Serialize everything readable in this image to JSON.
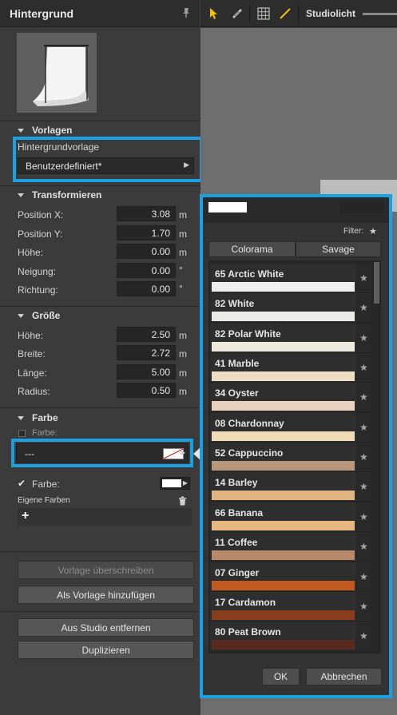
{
  "panel": {
    "title": "Hintergrund",
    "sections": {
      "vorlagen": "Vorlagen",
      "transformieren": "Transformieren",
      "groesse": "Größe",
      "farbe": "Farbe"
    },
    "vorlage": {
      "label": "Hintergrundvorlage",
      "value": "Benutzerdefiniert*"
    },
    "transform": [
      {
        "label": "Position X:",
        "value": "3.08",
        "unit": "m"
      },
      {
        "label": "Position Y:",
        "value": "1.70",
        "unit": "m"
      },
      {
        "label": "Höhe:",
        "value": "0.00",
        "unit": "m"
      },
      {
        "label": "Neigung:",
        "value": "0.00",
        "unit": "°"
      },
      {
        "label": "Richtung:",
        "value": "0.00",
        "unit": "°"
      }
    ],
    "size": [
      {
        "label": "Höhe:",
        "value": "2.50",
        "unit": "m"
      },
      {
        "label": "Breite:",
        "value": "2.72",
        "unit": "m"
      },
      {
        "label": "Länge:",
        "value": "5.00",
        "unit": "m"
      },
      {
        "label": "Radius:",
        "value": "0.50",
        "unit": "m"
      }
    ],
    "color": {
      "farbe_checkbox_label": "Farbe:",
      "dropdown_value": "---",
      "farbe2_label": "Farbe:",
      "eigene_farben": "Eigene Farben",
      "add_symbol": "+"
    },
    "buttons": {
      "overwrite": "Vorlage überschreiben",
      "add_template": "Als Vorlage hinzufügen",
      "remove": "Aus Studio entfernen",
      "duplicate": "Duplizieren"
    }
  },
  "toolbar": {
    "label": "Studiolicht"
  },
  "popup": {
    "filter_label": "Filter:",
    "tabs": [
      "Colorama",
      "Savage"
    ],
    "swatches": [
      {
        "name": "65 Arctic White",
        "color": "#efefef"
      },
      {
        "name": "82 White",
        "color": "#eaeae6"
      },
      {
        "name": "82 Polar White",
        "color": "#eee9dd"
      },
      {
        "name": "41 Marble",
        "color": "#ecdcc4"
      },
      {
        "name": "34 Oyster",
        "color": "#e6d2bf"
      },
      {
        "name": "08 Chardonnay",
        "color": "#efdcb7"
      },
      {
        "name": "52 Cappuccino",
        "color": "#b9977a"
      },
      {
        "name": "14 Barley",
        "color": "#dfb47f"
      },
      {
        "name": "66 Banana",
        "color": "#e6b77e"
      },
      {
        "name": "11 Coffee",
        "color": "#b7896a"
      },
      {
        "name": "07 Ginger",
        "color": "#c4591f"
      },
      {
        "name": "17 Cardamon",
        "color": "#8a3d1c"
      },
      {
        "name": "80 Peat Brown",
        "color": "#5a2a1f"
      }
    ],
    "ok": "OK",
    "cancel": "Abbrechen"
  },
  "accent_color": "#1ba1e2"
}
